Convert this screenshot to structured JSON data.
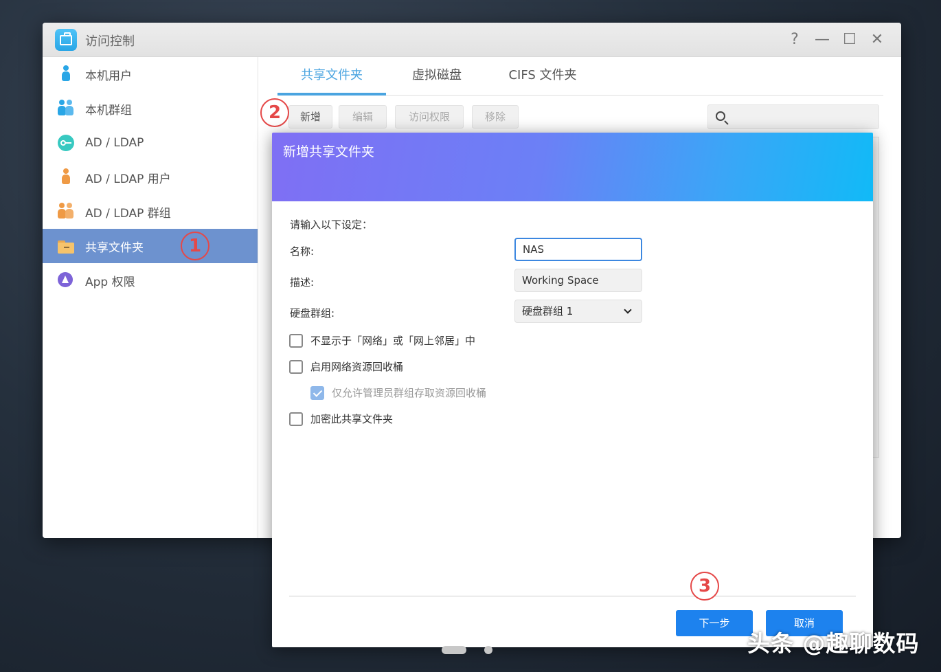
{
  "window": {
    "title": "访问控制",
    "controls": {
      "help": "?",
      "minimize": "—",
      "maximize": "☐",
      "close": "✕"
    }
  },
  "sidebar": {
    "items": [
      {
        "label": "本机用户",
        "icon": "user-icon"
      },
      {
        "label": "本机群组",
        "icon": "group-icon"
      },
      {
        "label": "AD / LDAP",
        "icon": "key-icon"
      },
      {
        "label": "AD / LDAP 用户",
        "icon": "ldap-user-icon"
      },
      {
        "label": "AD / LDAP 群组",
        "icon": "ldap-group-icon"
      },
      {
        "label": "共享文件夹",
        "icon": "folder-icon",
        "active": true
      },
      {
        "label": "App 权限",
        "icon": "app-icon"
      }
    ]
  },
  "markers": {
    "one": "1",
    "two": "2",
    "three": "3"
  },
  "tabs": [
    {
      "label": "共享文件夹",
      "active": true
    },
    {
      "label": "虚拟磁盘"
    },
    {
      "label": "CIFS 文件夹"
    }
  ],
  "toolbar": {
    "add": "新增",
    "edit": "编辑",
    "permissions": "访问权限",
    "remove": "移除"
  },
  "dialog": {
    "title": "新增共享文件夹",
    "intro": "请输入以下设定：",
    "name_label": "名称:",
    "name_value": "NAS",
    "desc_label": "描述:",
    "desc_value": "Working Space",
    "volume_label": "硬盘群组:",
    "volume_value": "硬盘群组 1",
    "options": [
      {
        "label": "不显示于「网络」或「网上邻居」中",
        "checked": false
      },
      {
        "label": "启用网络资源回收桶",
        "checked": false
      },
      {
        "label": "仅允许管理员群组存取资源回收桶",
        "checked": true,
        "disabled": true
      },
      {
        "label": "加密此共享文件夹",
        "checked": false
      }
    ],
    "next_button": "下一步",
    "cancel_button": "取消"
  },
  "watermark": "头条 @趣聊数码",
  "colors": {
    "accent": "#4aa4e0",
    "sidebar_active": "#6d92cf",
    "primary_button": "#1d82ee",
    "marker": "#e54848"
  }
}
